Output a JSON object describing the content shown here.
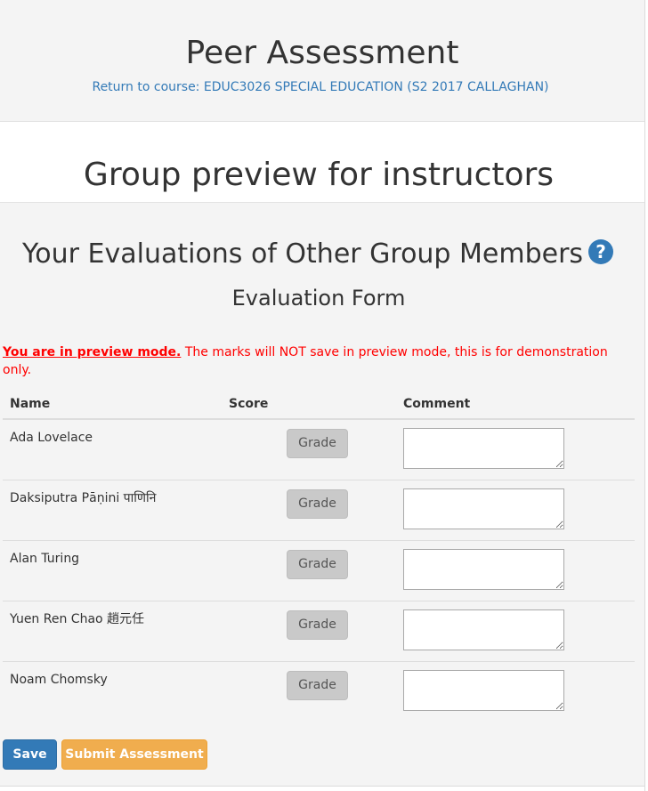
{
  "header": {
    "title": "Peer Assessment",
    "return_link": "Return to course: EDUC3026 SPECIAL EDUCATION (S2 2017 CALLAGHAN)"
  },
  "instructor_banner": {
    "title": "Group preview for instructors"
  },
  "evaluation": {
    "heading": "Your Evaluations of Other Group Members",
    "help_icon": "question-circle-icon",
    "help_glyph": "?",
    "form_title": "Evaluation Form",
    "preview_strong": "You are in preview mode.",
    "preview_text": " The marks will NOT save in preview mode, this is for demonstration only."
  },
  "table": {
    "columns": [
      "Name",
      "Score",
      "Comment"
    ],
    "rows": [
      {
        "name": "Ada Lovelace",
        "grade_label": "Grade",
        "comment": ""
      },
      {
        "name": "Daksiputra Pāṇini पाणिनि",
        "grade_label": "Grade",
        "comment": ""
      },
      {
        "name": "Alan Turing",
        "grade_label": "Grade",
        "comment": ""
      },
      {
        "name": "Yuen Ren Chao 趙元任",
        "grade_label": "Grade",
        "comment": ""
      },
      {
        "name": "Noam Chomsky",
        "grade_label": "Grade",
        "comment": ""
      }
    ]
  },
  "actions": {
    "save_label": "Save",
    "submit_label": "Submit Assessment"
  },
  "colors": {
    "link": "#337ab7",
    "warning_text": "#ff0000",
    "primary_button": "#337ab7",
    "submit_button": "#f0ad4e",
    "grade_button": "#c9c9c9"
  }
}
